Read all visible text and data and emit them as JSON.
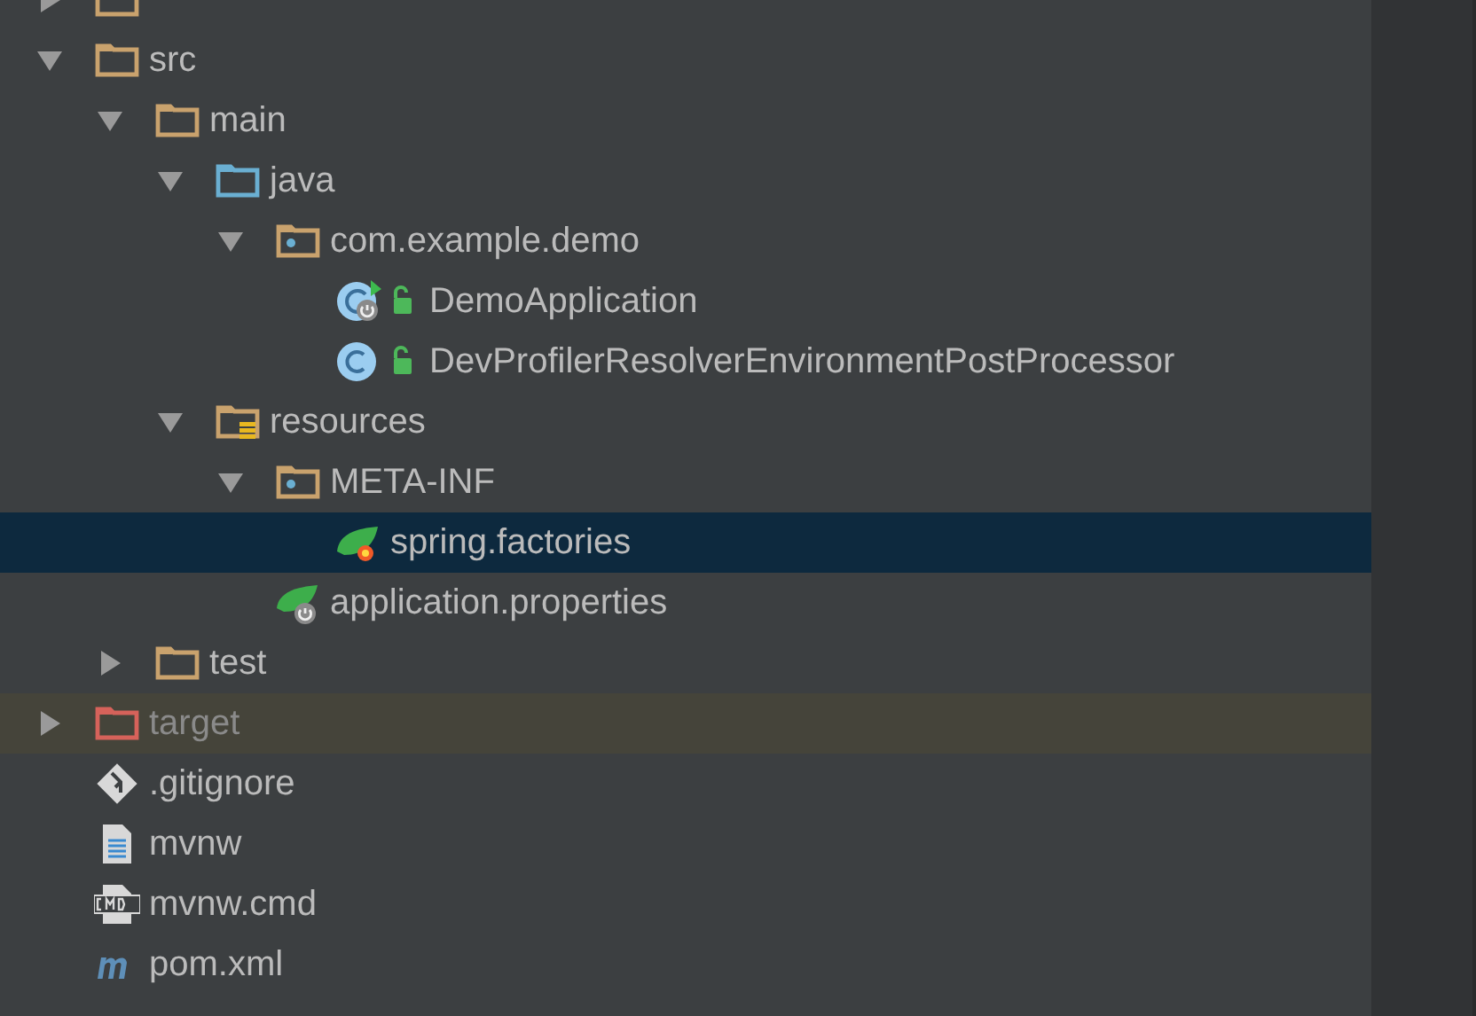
{
  "project_tree": {
    "items": [
      {
        "kind": "folder",
        "expanded": false,
        "selected": false,
        "excluded": false
      },
      {
        "kind": "folder",
        "label": "src",
        "expanded": true,
        "selected": false,
        "excluded": false,
        "children": [
          {
            "kind": "folder",
            "label": "main",
            "expanded": true,
            "selected": false,
            "excluded": false,
            "children": [
              {
                "kind": "source-folder",
                "label": "java",
                "expanded": true,
                "selected": false,
                "excluded": false,
                "children": [
                  {
                    "kind": "package",
                    "label": "com.example.demo",
                    "expanded": true,
                    "selected": false,
                    "excluded": false,
                    "children": [
                      {
                        "kind": "boot-class",
                        "label": "DemoApplication",
                        "selected": false,
                        "excluded": false
                      },
                      {
                        "kind": "class",
                        "label": "DevProfilerResolverEnvironmentPostProcessor",
                        "selected": false,
                        "excluded": false
                      }
                    ]
                  }
                ]
              },
              {
                "kind": "resource-folder",
                "label": "resources",
                "expanded": true,
                "selected": false,
                "excluded": false,
                "children": [
                  {
                    "kind": "package",
                    "label": "META-INF",
                    "expanded": true,
                    "selected": false,
                    "excluded": false,
                    "children": [
                      {
                        "kind": "spring-factories",
                        "label": "spring.factories",
                        "selected": true,
                        "excluded": false
                      }
                    ]
                  },
                  {
                    "kind": "spring-properties",
                    "label": "application.properties",
                    "selected": false,
                    "excluded": false
                  }
                ]
              }
            ]
          },
          {
            "kind": "folder",
            "label": "test",
            "expanded": false,
            "selected": false,
            "excluded": false
          }
        ]
      },
      {
        "kind": "folder",
        "label": "target",
        "expanded": false,
        "selected": false,
        "excluded": true
      },
      {
        "kind": "git",
        "label": ".gitignore",
        "selected": false,
        "excluded": false
      },
      {
        "kind": "text-file",
        "label": "mvnw",
        "selected": false,
        "excluded": false
      },
      {
        "kind": "cmd-file",
        "label": "mvnw.cmd",
        "selected": false,
        "excluded": false
      },
      {
        "kind": "maven",
        "label": "pom.xml",
        "selected": false,
        "excluded": false
      }
    ]
  }
}
